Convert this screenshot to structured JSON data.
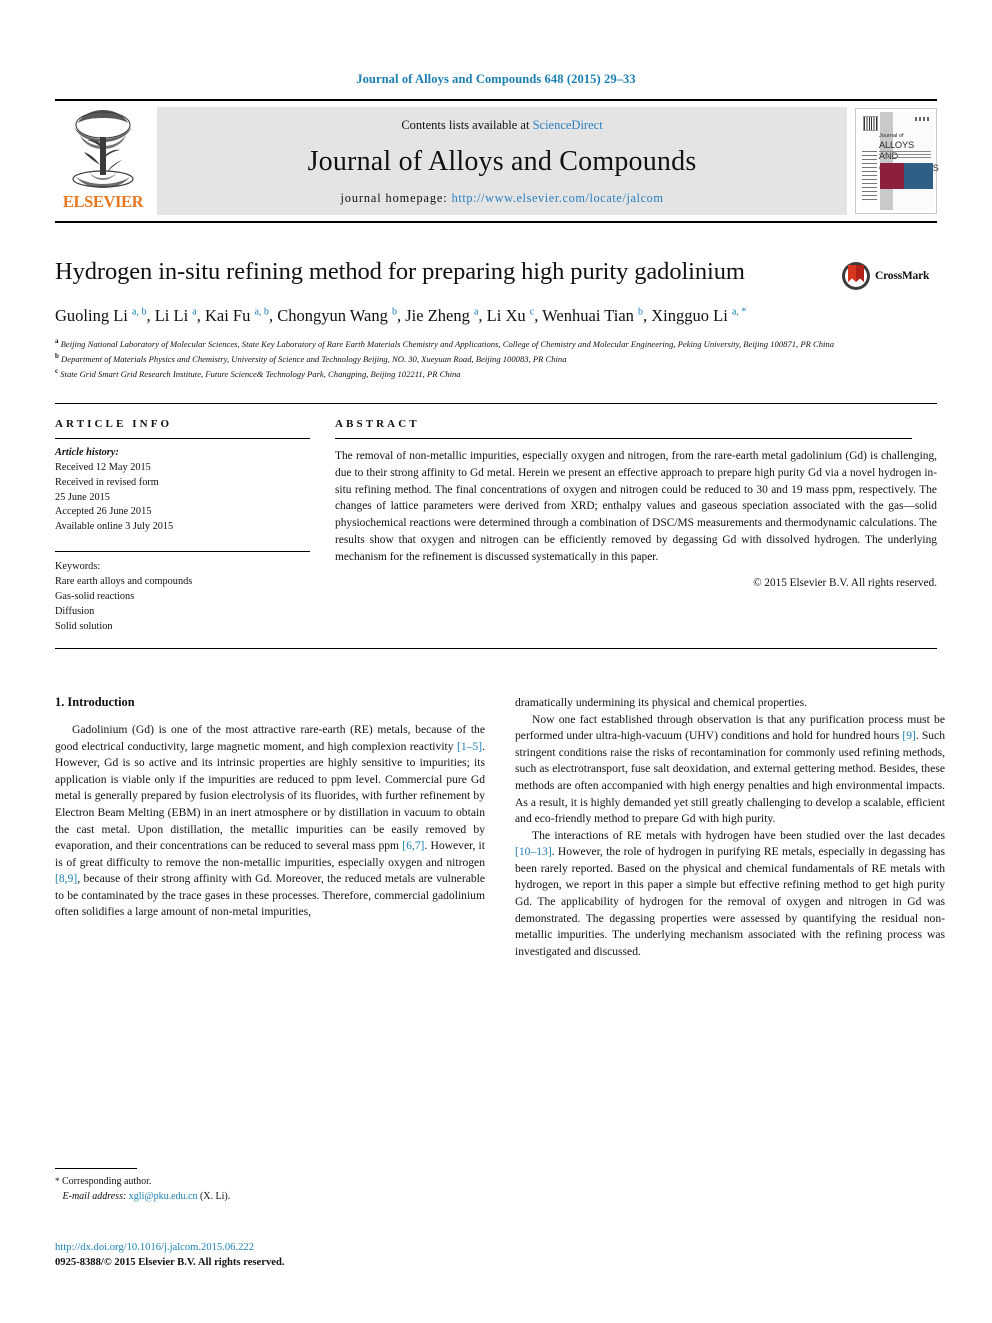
{
  "running_head": "Journal of Alloys and Compounds 648 (2015) 29–33",
  "masthead": {
    "contents_prefix": "Contents lists available at ",
    "sciencedirect": "ScienceDirect",
    "journal_name": "Journal of Alloys and Compounds",
    "homepage_label": "journal homepage: ",
    "homepage_url": "http://www.elsevier.com/locate/jalcom",
    "publisher": "ELSEVIER",
    "cover": {
      "line1": "Journal of",
      "line2": "ALLOYS",
      "line3": "AND COMPOUNDS"
    },
    "accent_blue": "#2a7fc0",
    "elsevier_orange": "#e87722"
  },
  "crossmark": {
    "label": "CrossMark"
  },
  "article": {
    "title": "Hydrogen in-situ refining method for preparing high purity gadolinium",
    "authors_html": "Guoling Li <sup>a, b</sup>, Li Li <sup>a</sup>, Kai Fu <sup>a, b</sup>, Chongyun Wang <sup>b</sup>, Jie Zheng <sup>a</sup>, Li Xu <sup>c</sup>, Wenhuai Tian <sup>b</sup>, Xingguo Li <sup>a, *</sup>",
    "affiliations": [
      "a Beijing National Laboratory of Molecular Sciences, State Key Laboratory of Rare Earth Materials Chemistry and Applications, College of Chemistry and Molecular Engineering, Peking University, Beijing 100871, PR China",
      "b Department of Materials Physics and Chemistry, University of Science and Technology Beijing, NO. 30, Xueyuan Road, Beijing 100083, PR China",
      "c State Grid Smart Grid Research Institute, Future Science& Technology Park, Changping, Beijing 102211, PR China"
    ]
  },
  "article_info": {
    "heading": "ARTICLE INFO",
    "history_label": "Article history:",
    "history": [
      "Received 12 May 2015",
      "Received in revised form",
      "25 June 2015",
      "Accepted 26 June 2015",
      "Available online 3 July 2015"
    ],
    "keywords_label": "Keywords:",
    "keywords": [
      "Rare earth alloys and compounds",
      "Gas-solid reactions",
      "Diffusion",
      "Solid solution"
    ]
  },
  "abstract": {
    "heading": "ABSTRACT",
    "text": "The removal of non-metallic impurities, especially oxygen and nitrogen, from the rare-earth metal gadolinium (Gd) is challenging, due to their strong affinity to Gd metal. Herein we present an effective approach to prepare high purity Gd via a novel hydrogen in-situ refining method. The final concentrations of oxygen and nitrogen could be reduced to 30 and 19 mass ppm, respectively. The changes of lattice parameters were derived from XRD; enthalpy values and gaseous speciation associated with the gas—solid physiochemical reactions were determined through a combination of DSC/MS measurements and thermodynamic calculations. The results show that oxygen and nitrogen can be efficiently removed by degassing Gd with dissolved hydrogen. The underlying mechanism for the refinement is discussed systematically in this paper.",
    "copyright": "© 2015 Elsevier B.V. All rights reserved."
  },
  "body": {
    "section_heading": "1.  Introduction",
    "left_paragraphs_html": [
      "Gadolinium (Gd) is one of the most attractive rare-earth (RE) metals, because of the good electrical conductivity, large magnetic moment, and high complexion reactivity <span class=\"ref\">[1–5]</span>. However, Gd is so active and its intrinsic properties are highly sensitive to impurities; its application is viable only if the impurities are reduced to ppm level. Commercial pure Gd metal is generally prepared by fusion electrolysis of its fluorides, with further refinement by Electron Beam Melting (EBM) in an inert atmosphere or by distillation in vacuum to obtain the cast metal. Upon distillation, the metallic impurities can be easily removed by evaporation, and their concentrations can be reduced to several mass ppm <span class=\"ref\">[6,7]</span>. However, it is of great difficulty to remove the non-metallic impurities, especially oxygen and nitrogen <span class=\"ref\">[8,9]</span>, because of their strong affinity with Gd. Moreover, the reduced metals are vulnerable to be contaminated by the trace gases in these processes. Therefore, commercial gadolinium often solidifies a large amount of non-metal impurities,"
    ],
    "right_paragraphs_html": [
      "dramatically undermining its physical and chemical properties.",
      "Now one fact established through observation is that any purification process must be performed under ultra-high-vacuum (UHV) conditions and hold for hundred hours <span class=\"ref\">[9]</span>. Such stringent conditions raise the risks of recontamination for commonly used refining methods, such as electrotransport, fuse salt deoxidation, and external gettering method. Besides, these methods are often accompanied with high energy penalties and high environmental impacts. As a result, it is highly demanded yet still greatly challenging to develop a scalable, efficient and eco-friendly method to prepare Gd with high purity.",
      "The interactions of RE metals with hydrogen have been studied over the last decades <span class=\"ref\">[10–13]</span>. However, the role of hydrogen in purifying RE metals, especially in degassing has been rarely reported. Based on the physical and chemical fundamentals of RE metals with hydrogen, we report in this paper a simple but effective refining method to get high purity Gd. The applicability of hydrogen for the removal of oxygen and nitrogen in Gd was demonstrated. The degassing properties were assessed by quantifying the residual non-metallic impurities. The underlying mechanism associated with the refining process was investigated and discussed."
    ]
  },
  "footnote": {
    "corresponding_author": "Corresponding author.",
    "email_label": "E-mail address:",
    "email": "xgli@pku.edu.cn",
    "email_suffix": "(X. Li)."
  },
  "publisher_footer": {
    "doi": "http://dx.doi.org/10.1016/j.jalcom.2015.06.222",
    "issn_line": "0925-8388/© 2015 Elsevier B.V. All rights reserved."
  }
}
